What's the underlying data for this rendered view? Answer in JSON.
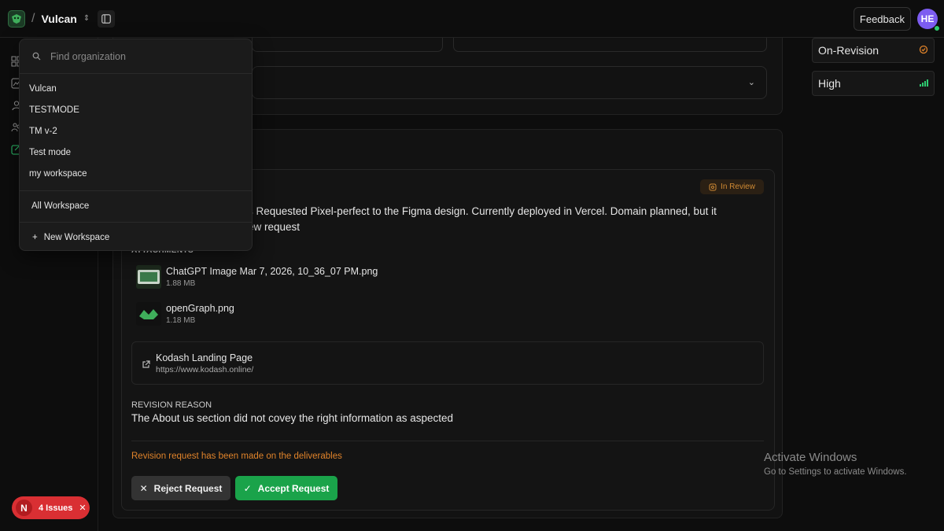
{
  "header": {
    "workspace_name": "Vulcan",
    "separator": "/",
    "feedback_label": "Feedback",
    "avatar_initials": "HE"
  },
  "status": {
    "state_label": "On-Revision",
    "priority_label": "High",
    "state_color": "#e0832a",
    "priority_color": "#2ecc71"
  },
  "org_dropdown": {
    "search_placeholder": "Find organization",
    "organizations": [
      "Vulcan",
      "TESTMODE",
      "TM v-2",
      "Test mode",
      "my workspace"
    ],
    "all_label": "All Workspace",
    "new_label": "New Workspace"
  },
  "deliverable": {
    "badge": "In Review",
    "description_line1": "s Requested Pixel-perfect to the Figma design. Currently deployed in Vercel. Domain planned, but it",
    "description_line2": "ew request",
    "attachments_label": "ATTACHMENTS",
    "attachments": [
      {
        "name": "ChatGPT Image Mar 7, 2026, 10_36_07 PM.png",
        "size": "1.88 MB"
      },
      {
        "name": "openGraph.png",
        "size": "1.18 MB"
      }
    ],
    "link": {
      "title": "Kodash Landing Page",
      "url": "https://www.kodash.online/"
    },
    "revision_label": "REVISION REASON",
    "revision_text": "The About us section did not covey the right information as aspected",
    "revision_note": "Revision request has been made on the deliverables",
    "reject_label": "Reject Request",
    "accept_label": "Accept Request"
  },
  "watermark": {
    "title": "Activate Windows",
    "subtitle": "Go to Settings to activate Windows."
  },
  "issues_badge": {
    "letter": "N",
    "label": "4 Issues"
  }
}
